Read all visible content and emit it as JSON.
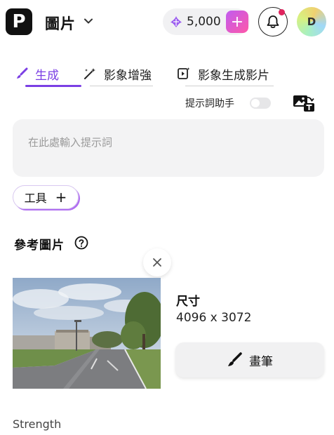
{
  "header": {
    "logo_letter": "P",
    "title": "圖片",
    "credits": "5,000",
    "credits_add": "+",
    "avatar_initial": "D"
  },
  "tabs": [
    {
      "label": "生成",
      "active": true,
      "icon": "brush-icon"
    },
    {
      "label": "影象增強",
      "active": false,
      "icon": "magic-wand-icon"
    },
    {
      "label": "影象生成影片",
      "active": false,
      "icon": "video-sparkle-icon"
    }
  ],
  "prompt": {
    "helper_label": "提示詞助手",
    "helper_enabled": false,
    "placeholder": "在此處輸入提示詞"
  },
  "tools": {
    "label": "工具",
    "plus": "+"
  },
  "reference": {
    "title": "參考圖片",
    "size_label": "尺寸",
    "size_value": "4096 x 3072",
    "brush_label": "畫筆"
  },
  "strength": {
    "label": "Strength"
  },
  "colors": {
    "accent": "#7b3fe4",
    "credits_plus_gradient": [
      "#c05cf0",
      "#ff58a8"
    ],
    "notification_dot": "#e0245e"
  }
}
